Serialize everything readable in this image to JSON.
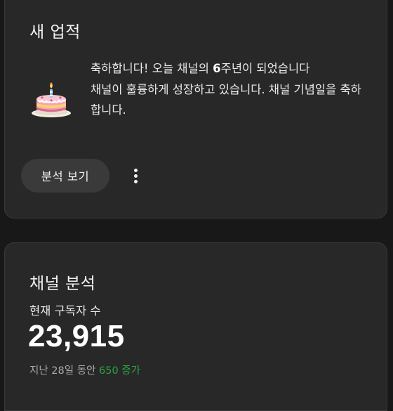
{
  "achievement_card": {
    "title": "새 업적",
    "message_part1": "축하합니다! 오늘 채널의 ",
    "message_years": "6",
    "message_part2": "주년이 되었습니다",
    "message_line2": "채널이 훌륭하게 성장하고 있습니다. 채널 기념일을 축하합니다.",
    "action_label": "분석 보기",
    "more_icon": "more-vertical-icon",
    "cake_icon": "birthday-cake-icon"
  },
  "analytics_card": {
    "title": "채널 분석",
    "subscriber_label": "현재 구독자 수",
    "subscriber_count": "23,915",
    "change_prefix": "지난 ",
    "change_days": "28",
    "change_mid": "일 동안 ",
    "change_value": "650 증가"
  },
  "colors": {
    "background": "#181818",
    "card": "#282828",
    "button": "#3a3a3a",
    "positive": "#2ba640"
  }
}
